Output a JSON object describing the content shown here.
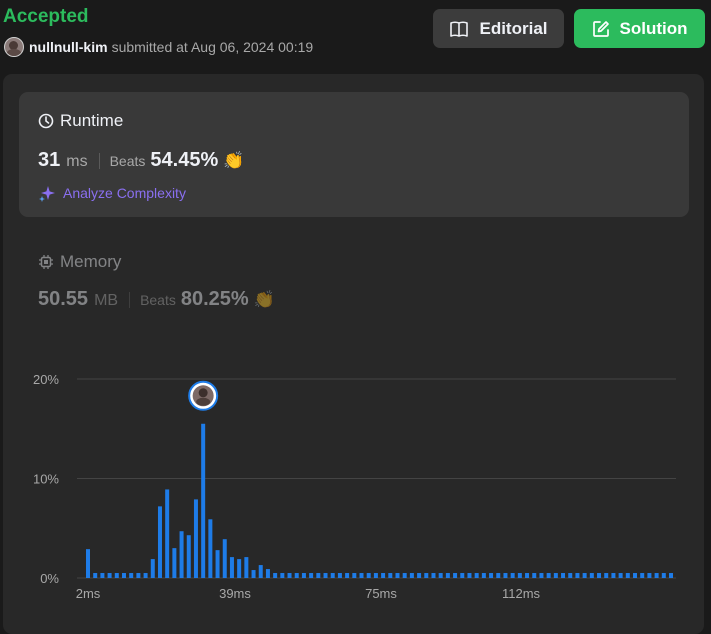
{
  "header": {
    "status": "Accepted",
    "username": "nullnull-kim",
    "submitted_text": "submitted at Aug 06, 2024 00:19",
    "editorial_label": "Editorial",
    "solution_label": "Solution"
  },
  "runtime": {
    "title": "Runtime",
    "value": "31",
    "unit": "ms",
    "beats_label": "Beats",
    "beats_value": "54.45%",
    "analyze_label": "Analyze Complexity"
  },
  "memory": {
    "title": "Memory",
    "value": "50.55",
    "unit": "MB",
    "beats_label": "Beats",
    "beats_value": "80.25%"
  },
  "colors": {
    "accent_green": "#2cbb5d",
    "bar_blue": "#1e7ce8",
    "analyze_purple": "#8a6ff0"
  },
  "chart_data": {
    "type": "bar",
    "ylim": [
      0,
      20
    ],
    "ytick_labels": [
      "20%",
      "10%",
      "0%"
    ],
    "xtick_labels": [
      "2ms",
      "39ms",
      "75ms",
      "112ms"
    ],
    "highlight_index": 16,
    "values": [
      2.9,
      0.5,
      0.5,
      0.5,
      0.5,
      0.5,
      0.5,
      0.5,
      0.5,
      1.9,
      7.2,
      8.9,
      3.0,
      4.7,
      4.3,
      7.9,
      15.5,
      5.9,
      2.8,
      3.9,
      2.1,
      1.9,
      2.1,
      0.8,
      1.3,
      0.9,
      0.5,
      0.5,
      0.5,
      0.5,
      0.5,
      0.5,
      0.5,
      0.5,
      0.5,
      0.5,
      0.5,
      0.5,
      0.5,
      0.5,
      0.5,
      0.5,
      0.5,
      0.5,
      0.5,
      0.5,
      0.5,
      0.5,
      0.5,
      0.5,
      0.5,
      0.5,
      0.5,
      0.5,
      0.5,
      0.5,
      0.5,
      0.5,
      0.5,
      0.5,
      0.5,
      0.5,
      0.5,
      0.5,
      0.5,
      0.5,
      0.5,
      0.5,
      0.5,
      0.5,
      0.5,
      0.5,
      0.5,
      0.5,
      0.5,
      0.5,
      0.5,
      0.5,
      0.5,
      0.5,
      0.5,
      0.5
    ]
  }
}
